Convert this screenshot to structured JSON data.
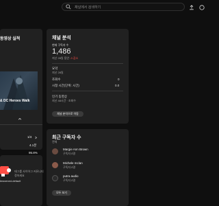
{
  "search": {
    "placeholder": "채널에서 검색하기"
  },
  "latest_video": {
    "title_prefix": "동영상 실적",
    "video_title": "& DC Heroes Walk",
    "stats": [
      {
        "value": "1/4"
      },
      {
        "value": "4.1분"
      },
      {
        "value": "95.8%"
      },
      {
        "value": "131"
      }
    ],
    "button": "댓글 보기(0)"
  },
  "channel_analytics": {
    "title": "채널 분석",
    "subs_label": "현재 구독자 수",
    "subs_count": "1,486",
    "subs_change_prefix": "지난 28일 동안",
    "subs_change": "-3 감소",
    "summary_title": "요약",
    "summary_period": "지난 28일",
    "views_label": "조회수",
    "views_value": "0",
    "watch_label": "시청 시간(단위: 시간)",
    "watch_value": "0.0",
    "popular_title": "인기 동영상",
    "popular_period": "지난 48시간 · 조회수",
    "analytics_button": "채널 분석으로 이동"
  },
  "recent_subs": {
    "title": "최근 구독자 수",
    "period": "전체",
    "items": [
      {
        "name": "Margie Ann Brown",
        "meta": "구독자 0명"
      },
      {
        "name": "Michele mclan",
        "meta": "구독자 0명"
      },
      {
        "name": "putra audio",
        "meta": "구독자 0명"
      }
    ],
    "button": "모두 보기"
  },
  "left_bottom": {
    "text1": "태그를 사이어그 커뮤니티",
    "text2": "정하세요",
    "tag": "lewxened-default"
  },
  "colors": {
    "accent_red": "#ff4e45",
    "bg": "#0f0f0f",
    "card": "#212121"
  }
}
